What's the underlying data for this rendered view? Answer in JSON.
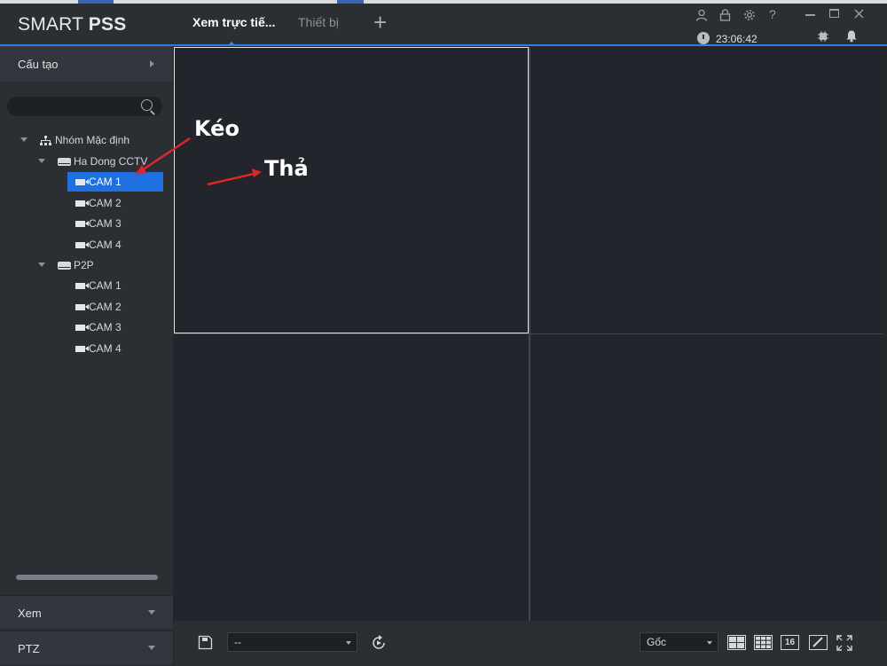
{
  "app": {
    "logo_light": "SMART ",
    "logo_bold": "PSS"
  },
  "tabs": [
    {
      "label": "Xem trực tiế..."
    },
    {
      "label": "Thiết bị"
    }
  ],
  "header": {
    "time": "23:06:42"
  },
  "sidebar": {
    "section_title": "Cấu tạo",
    "search_placeholder": "",
    "tree": {
      "root": "Nhóm Mặc định",
      "devices": [
        {
          "name": "Ha Dong CCTV",
          "cameras": [
            "CAM 1",
            "CAM 2",
            "CAM 3",
            "CAM 4"
          ],
          "selected_camera": "CAM 1"
        },
        {
          "name": "P2P",
          "cameras": [
            "CAM 1",
            "CAM 2",
            "CAM 3",
            "CAM 4"
          ]
        }
      ]
    },
    "footer_view": "Xem",
    "footer_ptz": "PTZ"
  },
  "annotations": {
    "drag": "Kéo",
    "drop": "Thả",
    "arrow_color": "#e0262b"
  },
  "bottombar": {
    "stream_select": "--",
    "ratio_select": "Gốc",
    "layout16": "16"
  },
  "colors": {
    "accent": "#2f7de1",
    "selection": "#1e6fe0"
  }
}
